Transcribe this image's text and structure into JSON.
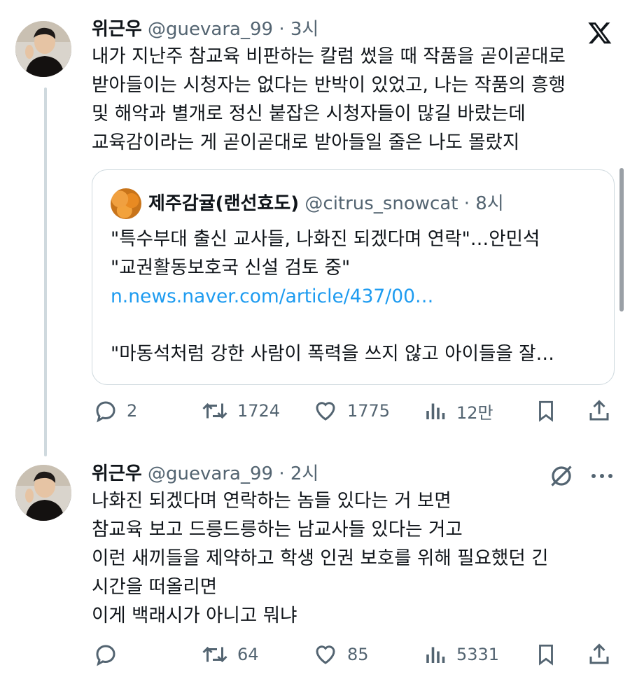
{
  "tweet1": {
    "name": "위근우",
    "handle": "@guevara_99",
    "time": "· 3시",
    "lines": [
      "내가 지난주 참교육 비판하는 칼럼 썼을 때 작품을 곧이곧대로",
      "받아들이는 시청자는 없다는 반박이 있었고, 나는 작품의 흥행",
      "및 해악과 별개로 정신 붙잡은 시청자들이 많길 바랐는데",
      "교육감이라는 게 곧이곧대로 받아들일 줄은 나도 몰랐지"
    ],
    "quote": {
      "name": "제주감귤(랜선효도)",
      "handle": "@citrus_snowcat",
      "time": "· 8시",
      "line1": "\"특수부대 출신 교사들, 나화진 되겠다며 연락\"…안민석",
      "line2": "\"교권활동보호국 신설 검토 중\"",
      "link": "n.news.naver.com/article/437/00…",
      "line3": "\"마동석처럼 강한 사람이 폭력을 쓰지 않고 아이들을 잘…"
    },
    "actions": {
      "replies": "2",
      "retweets": "1724",
      "likes": "1775",
      "views": "12만"
    }
  },
  "tweet2": {
    "name": "위근우",
    "handle": "@guevara_99",
    "time": "· 2시",
    "lines": [
      "나화진 되겠다며 연락하는 놈들 있다는 거 보면",
      "참교육 보고 드릉드릉하는 남교사들 있다는 거고",
      "이런 새끼들을 제약하고 학생 인권 보호를 위해 필요했던 긴",
      "시간을 떠올리면",
      "이게 백래시가 아니고 뭐냐"
    ],
    "actions": {
      "replies": "",
      "retweets": "64",
      "likes": "85",
      "views": "5331"
    }
  },
  "icons": {
    "logo": "x-logo-icon",
    "reply": "reply-icon",
    "retweet": "retweet-icon",
    "like": "heart-icon",
    "views": "views-icon",
    "bookmark": "bookmark-icon",
    "share": "share-icon",
    "grok": "grok-icon",
    "more": "more-icon"
  },
  "colors": {
    "link": "#1d9bf0",
    "secondary": "#536471",
    "border": "#cfd9de"
  }
}
